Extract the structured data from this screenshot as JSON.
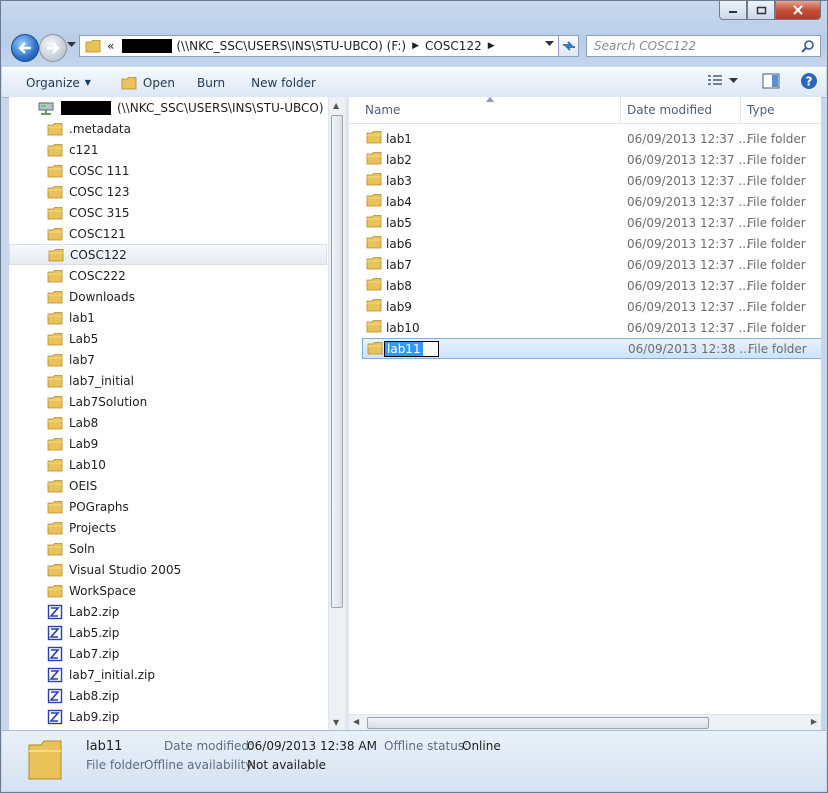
{
  "address": {
    "overflow": "«",
    "path_suffix": "(\\\\NKC_SSC\\USERS\\INS\\STU-UBCO) (F:)",
    "current": "COSC122"
  },
  "search": {
    "placeholder": "Search COSC122"
  },
  "toolbar": {
    "organize": "Organize",
    "open": "Open",
    "burn": "Burn",
    "new_folder": "New folder"
  },
  "navpane": {
    "drive_label": "(\\\\NKC_SSC\\USERS\\INS\\STU-UBCO) (F:)",
    "items": [
      {
        "label": ".metadata",
        "kind": "folder"
      },
      {
        "label": "c121",
        "kind": "folder"
      },
      {
        "label": "COSC 111",
        "kind": "folder"
      },
      {
        "label": "COSC 123",
        "kind": "folder"
      },
      {
        "label": "COSC 315",
        "kind": "folder"
      },
      {
        "label": "COSC121",
        "kind": "folder"
      },
      {
        "label": "COSC122",
        "kind": "folder",
        "selected": true
      },
      {
        "label": "COSC222",
        "kind": "folder"
      },
      {
        "label": "Downloads",
        "kind": "folder"
      },
      {
        "label": "lab1",
        "kind": "folder"
      },
      {
        "label": "Lab5",
        "kind": "folder"
      },
      {
        "label": "lab7",
        "kind": "folder"
      },
      {
        "label": "lab7_initial",
        "kind": "folder"
      },
      {
        "label": "Lab7Solution",
        "kind": "folder"
      },
      {
        "label": "Lab8",
        "kind": "folder"
      },
      {
        "label": "Lab9",
        "kind": "folder"
      },
      {
        "label": "Lab10",
        "kind": "folder"
      },
      {
        "label": "OEIS",
        "kind": "folder"
      },
      {
        "label": "POGraphs",
        "kind": "folder"
      },
      {
        "label": "Projects",
        "kind": "folder"
      },
      {
        "label": "Soln",
        "kind": "folder"
      },
      {
        "label": "Visual Studio 2005",
        "kind": "folder"
      },
      {
        "label": "WorkSpace",
        "kind": "folder"
      },
      {
        "label": "Lab2.zip",
        "kind": "zip"
      },
      {
        "label": "Lab5.zip",
        "kind": "zip"
      },
      {
        "label": "Lab7.zip",
        "kind": "zip"
      },
      {
        "label": "lab7_initial.zip",
        "kind": "zip"
      },
      {
        "label": "Lab8.zip",
        "kind": "zip"
      },
      {
        "label": "Lab9.zip",
        "kind": "zip"
      }
    ]
  },
  "columns": {
    "name": "Name",
    "date": "Date modified",
    "type": "Type"
  },
  "files": [
    {
      "name": "lab1",
      "date": "06/09/2013 12:37 ...",
      "type": "File folder"
    },
    {
      "name": "lab2",
      "date": "06/09/2013 12:37 ...",
      "type": "File folder"
    },
    {
      "name": "lab3",
      "date": "06/09/2013 12:37 ...",
      "type": "File folder"
    },
    {
      "name": "lab4",
      "date": "06/09/2013 12:37 ...",
      "type": "File folder"
    },
    {
      "name": "lab5",
      "date": "06/09/2013 12:37 ...",
      "type": "File folder"
    },
    {
      "name": "lab6",
      "date": "06/09/2013 12:37 ...",
      "type": "File folder"
    },
    {
      "name": "lab7",
      "date": "06/09/2013 12:37 ...",
      "type": "File folder"
    },
    {
      "name": "lab8",
      "date": "06/09/2013 12:37 ...",
      "type": "File folder"
    },
    {
      "name": "lab9",
      "date": "06/09/2013 12:37 ...",
      "type": "File folder"
    },
    {
      "name": "lab10",
      "date": "06/09/2013 12:37 ...",
      "type": "File folder"
    },
    {
      "name": "lab11",
      "date": "06/09/2013 12:38 ...",
      "type": "File folder",
      "renaming": true
    }
  ],
  "details": {
    "name": "lab11",
    "kind": "File folder",
    "date_label": "Date modified:",
    "date_value": "06/09/2013 12:38 AM",
    "offline_status_label": "Offline status:",
    "offline_status_value": "Online",
    "offline_avail_label": "Offline availability:",
    "offline_avail_value": "Not available"
  },
  "colors": {
    "accent": "#3399ff",
    "folder": "#e9c25a",
    "toolbar_text": "#1e395b"
  }
}
